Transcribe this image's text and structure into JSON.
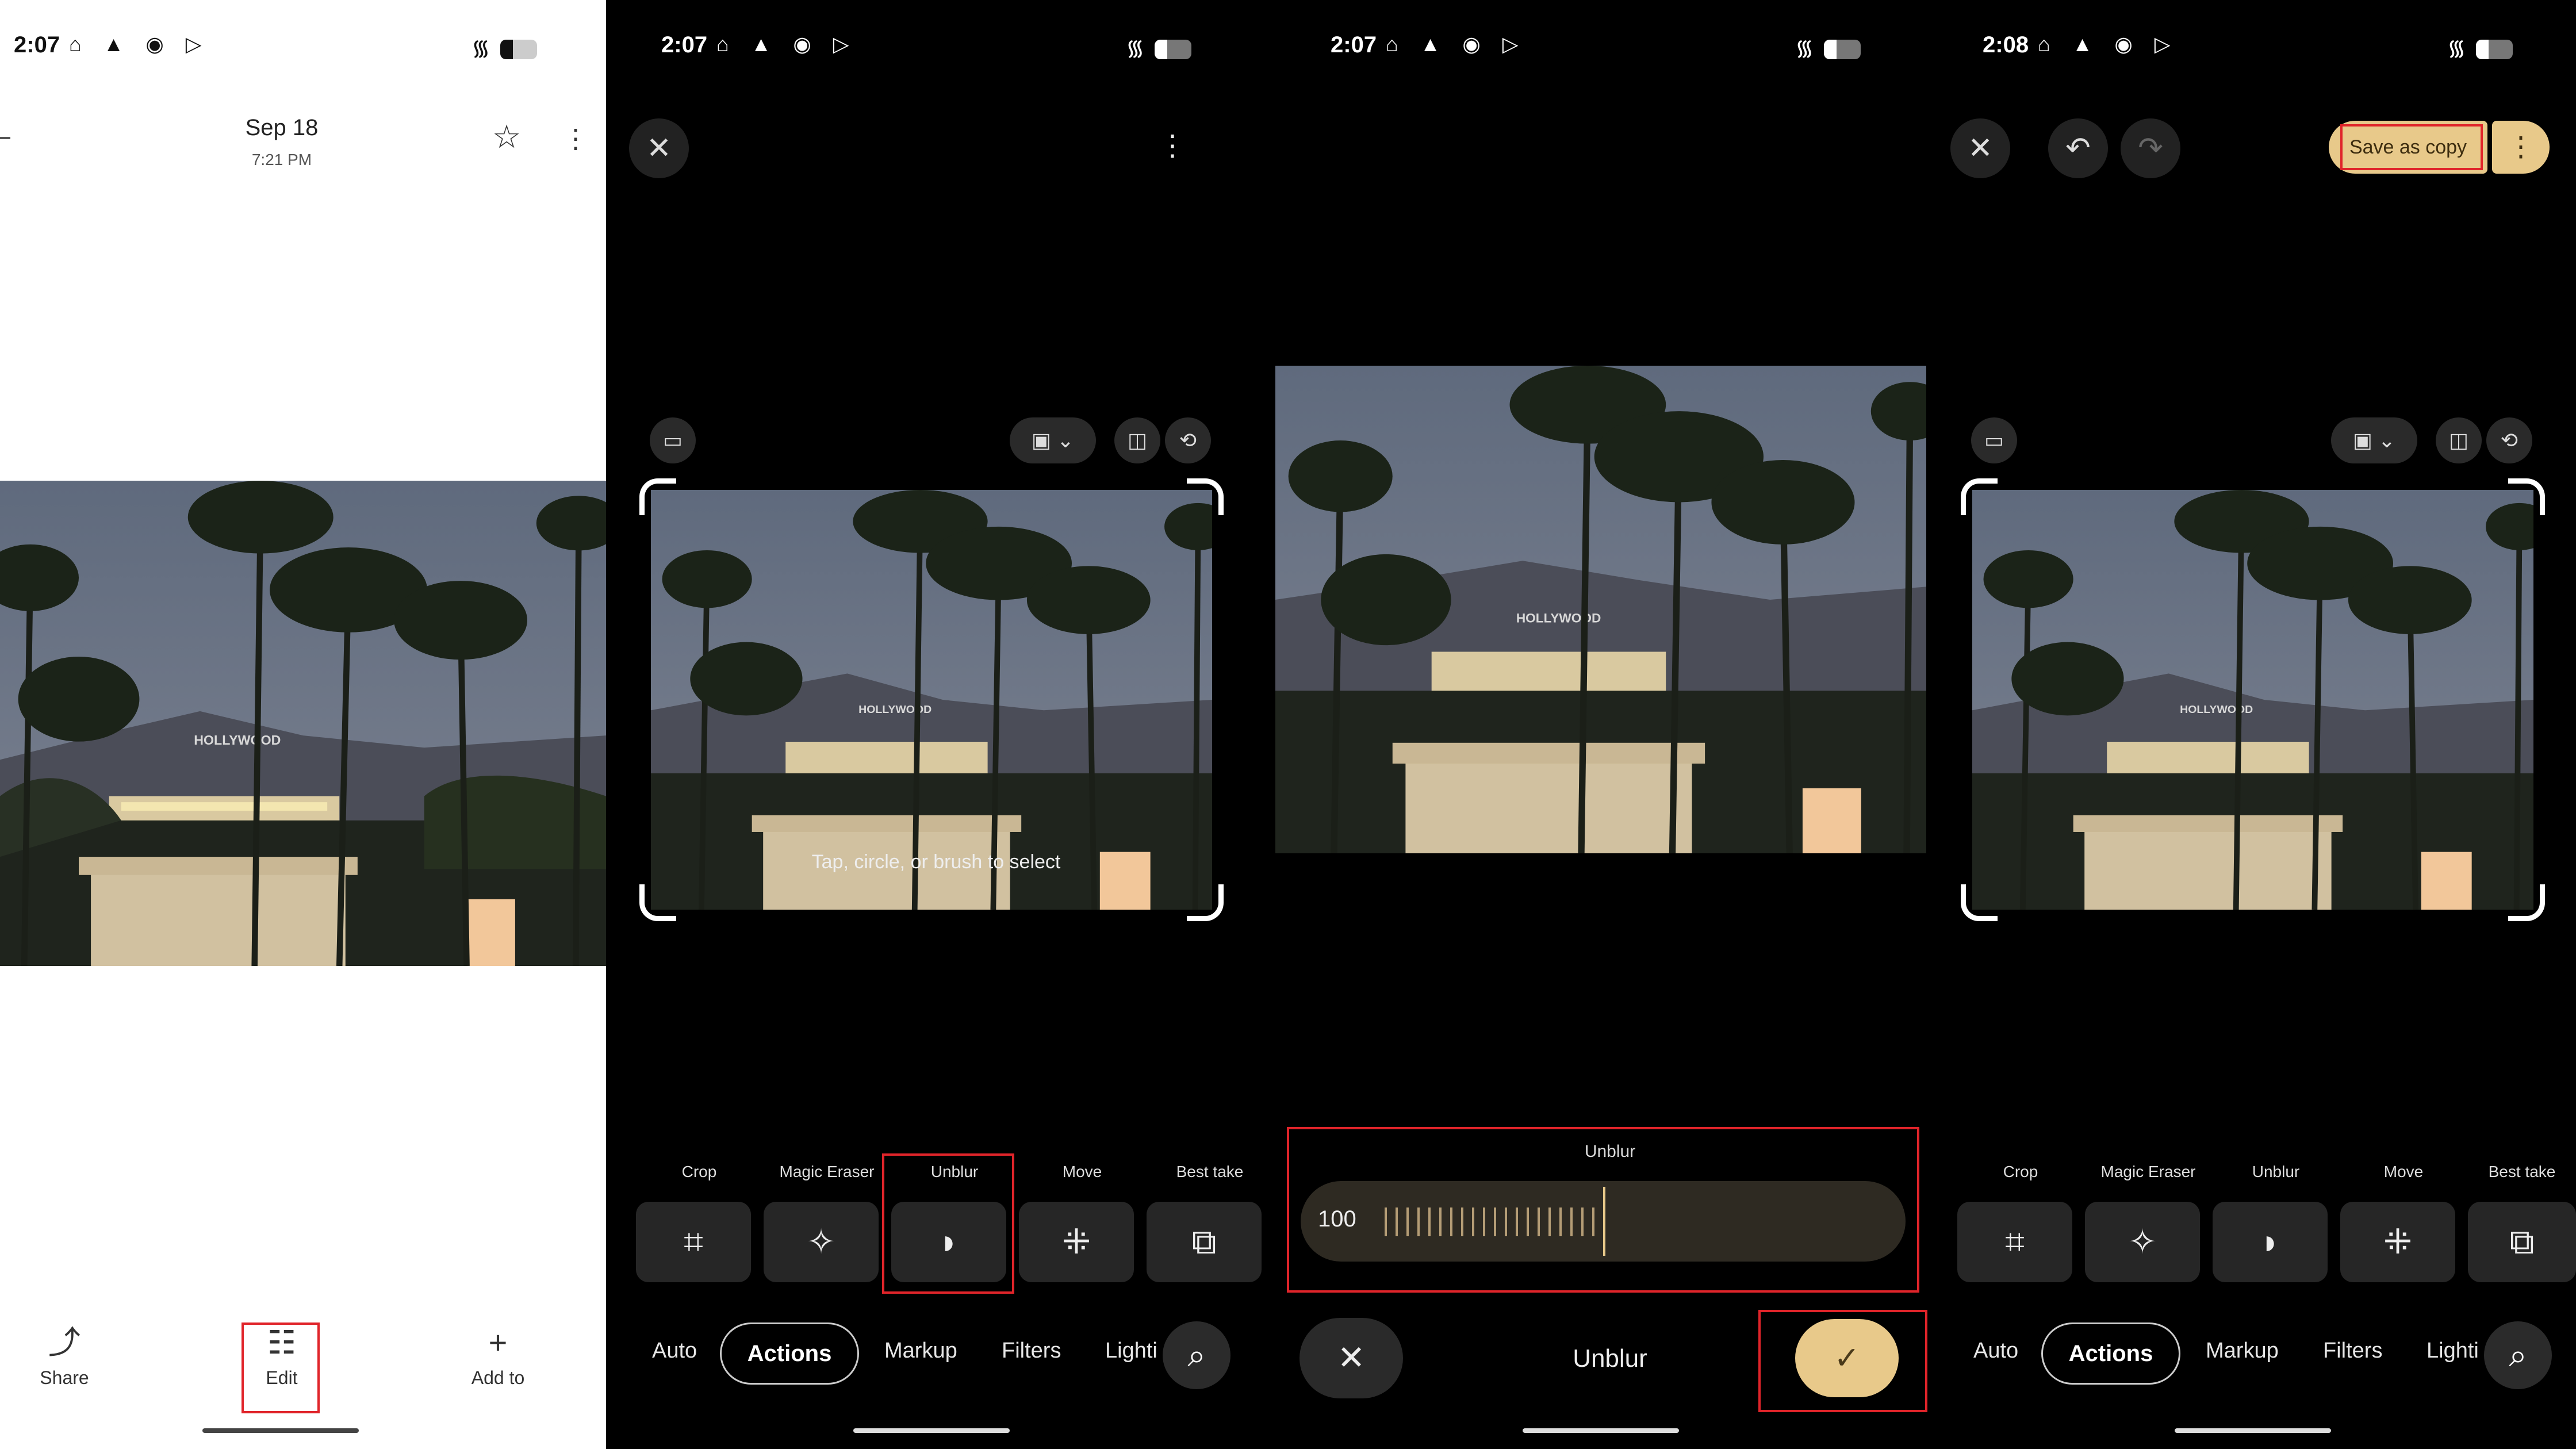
{
  "status": {
    "panel1_time": "2:07",
    "panel2_time": "2:07",
    "panel3_time": "2:07",
    "panel4_time": "2:08",
    "icons": "⌂ ▲ ◉ ▷",
    "wifi": "▾"
  },
  "viewer": {
    "date": "Sep 18",
    "time": "7:21 PM",
    "share_label": "Share",
    "edit_label": "Edit",
    "add_label": "Add to"
  },
  "editor": {
    "hint": "Tap, circle, or brush to select",
    "tools": [
      "Crop",
      "Magic Eraser",
      "Unblur",
      "Move",
      "Best take"
    ],
    "categories": {
      "auto": "Auto",
      "actions": "Actions",
      "markup": "Markup",
      "filters": "Filters",
      "lighting": "Lighti"
    }
  },
  "unblur": {
    "slider_title": "Unblur",
    "value": 100,
    "footer_title": "Unblur"
  },
  "save": {
    "save_copy_label": "Save as copy"
  },
  "photo": {
    "sign_text": "HOLLYWOOD"
  },
  "colors": {
    "accent": "#e8c98a",
    "highlight": "#e0242a",
    "sky": "#6b7384"
  }
}
